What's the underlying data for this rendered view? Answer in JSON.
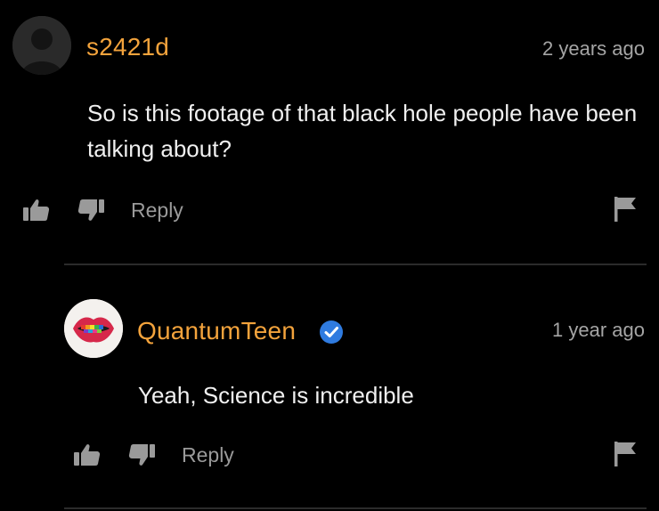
{
  "colors": {
    "background": "#000000",
    "username": "#f3a33c",
    "text": "#f0f0f0",
    "muted": "#9a9a9a",
    "divider": "#2b2b2b",
    "verified": "#2f7be0"
  },
  "comments": [
    {
      "username": "s2421d",
      "timestamp": "2 years ago",
      "body": "So is this footage of that black hole people have been talking about?",
      "reply_label": "Reply",
      "avatar_icon": "default-user-icon",
      "verified": false
    },
    {
      "username": "QuantumTeen",
      "timestamp": "1 year ago",
      "body": "Yeah, Science is incredible",
      "reply_label": "Reply",
      "avatar_icon": "rainbow-lips-avatar",
      "verified": true
    }
  ]
}
